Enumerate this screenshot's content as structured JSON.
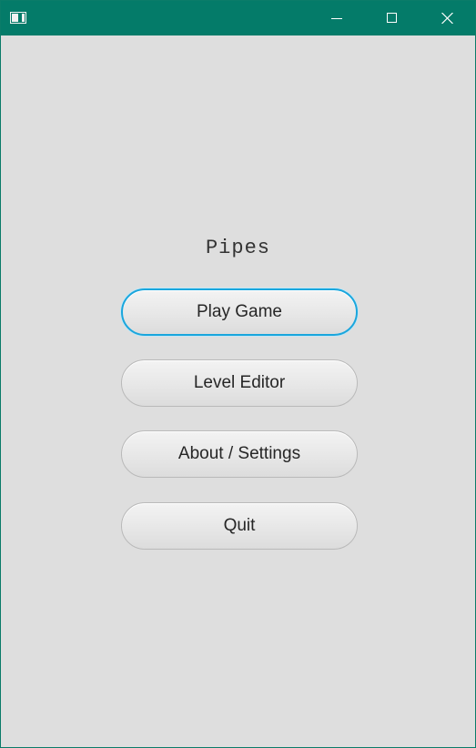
{
  "window": {
    "controls": {
      "minimize_icon": "minimize-icon",
      "maximize_icon": "maximize-icon",
      "close_icon": "close-icon"
    },
    "titlebar_color": "#047b69",
    "background_color": "#dedede"
  },
  "menu": {
    "title": "Pipes",
    "buttons": {
      "play": "Play Game",
      "editor": "Level Editor",
      "about": "About / Settings",
      "quit": "Quit"
    },
    "focused_button": "Play Game",
    "focus_color": "#1aa6dd"
  }
}
